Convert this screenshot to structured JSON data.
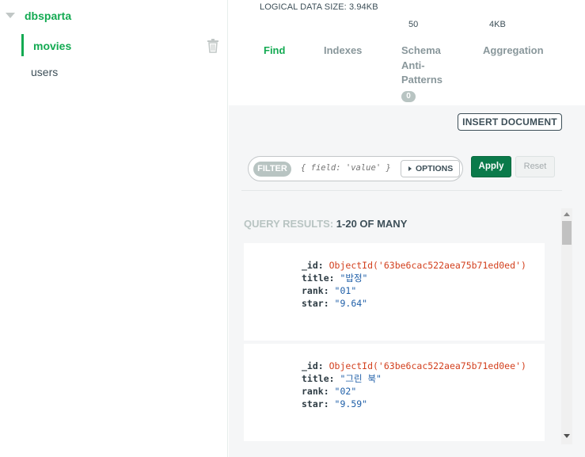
{
  "sidebar": {
    "database": "dbsparta",
    "collections": [
      {
        "label": "movies",
        "active": true
      },
      {
        "label": "users",
        "active": false
      }
    ],
    "trash_icon": "trash-icon"
  },
  "header": {
    "logical_size_label": "LOGICAL DATA SIZE:",
    "logical_size_value": "3.94KB",
    "stat_docs": "50",
    "stat_size": "4KB",
    "tabs": [
      {
        "label": "Find",
        "active": true
      },
      {
        "label": "Indexes",
        "active": false
      },
      {
        "label": "Schema\nAnti-\nPatterns",
        "active": false,
        "badge": "0"
      },
      {
        "label": "Aggregation",
        "active": false
      }
    ]
  },
  "toolbar": {
    "insert_label": "INSERT DOCUMENT",
    "filter_pill": "FILTER",
    "filter_placeholder": "{ field: 'value' }",
    "options_label": "OPTIONS",
    "apply_label": "Apply",
    "reset_label": "Reset"
  },
  "results": {
    "label": "QUERY RESULTS:",
    "count": "1-20 OF MANY",
    "documents": [
      {
        "id": "ObjectId('63be6cac522aea75b71ed0ed')",
        "title": "\"밥정\"",
        "rank": "\"01\"",
        "star": "\"9.64\""
      },
      {
        "id": "ObjectId('63be6cac522aea75b71ed0ee')",
        "title": "\"그린 북\"",
        "rank": "\"02\"",
        "star": "\"9.59\""
      }
    ]
  },
  "colors": {
    "accent": "#13aa52",
    "apply": "#0a7a4a",
    "objectid": "#d3401e",
    "string": "#1f5fa8"
  }
}
